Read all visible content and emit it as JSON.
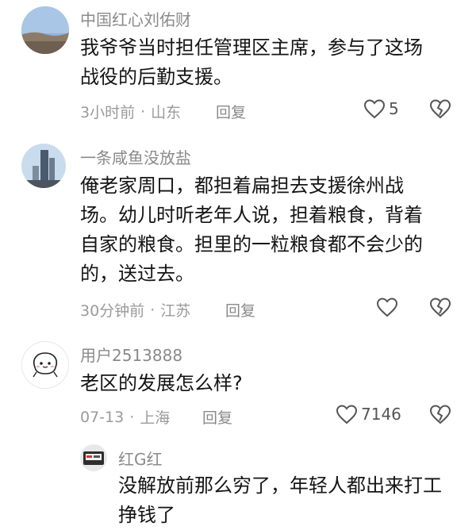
{
  "comments": [
    {
      "username": "中国红心刘佑财",
      "text_lines": [
        "我爷爷当时担任管理区主席，参与了这场",
        "战役的后勤支援。"
      ],
      "time": "3小时前",
      "location": "山东",
      "reply_label": "回复",
      "like_count": "5"
    },
    {
      "username": "一条咸鱼没放盐",
      "text_lines": [
        "俺老家周口，都担着扁担去支援徐州战",
        "场。幼儿时听老年人说，担着粮食，背着",
        "自家的粮食。担里的一粒粮食都不会少的",
        "的，送过去。"
      ],
      "time": "30分钟前",
      "location": "江苏",
      "reply_label": "回复",
      "like_count": ""
    },
    {
      "username": "用户2513888",
      "text_lines": [
        "老区的发展怎么样?"
      ],
      "time": "07-13",
      "location": "上海",
      "reply_label": "回复",
      "like_count": "7146"
    }
  ],
  "reply": {
    "username": "红G红",
    "text_lines": [
      "没解放前那么穷了，年轻人都出来打工",
      "挣钱了"
    ]
  },
  "meta_separator": "·",
  "colors": {
    "meta": "#9a9a9a",
    "text": "#141414",
    "icon": "#555555"
  }
}
